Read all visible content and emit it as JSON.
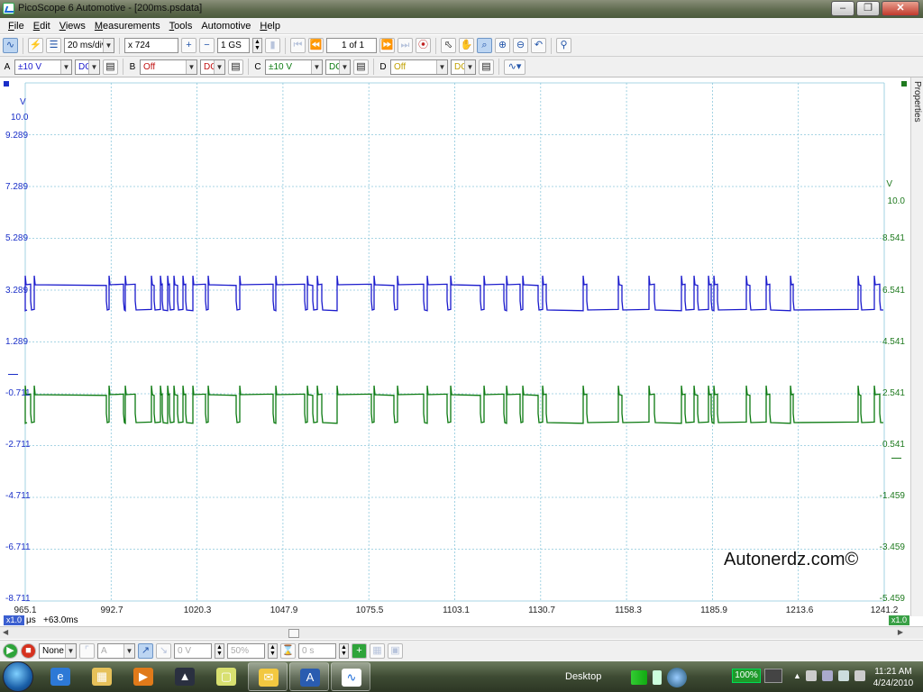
{
  "window": {
    "title": "PicoScope 6 Automotive - [200ms.psdata]",
    "minimize_icon": "minimize-icon",
    "maximize_icon": "restore-icon",
    "close_icon": "close-icon"
  },
  "menu": [
    {
      "label": "File",
      "key": "F",
      "rest": "ile"
    },
    {
      "label": "Edit",
      "key": "E",
      "rest": "dit"
    },
    {
      "label": "Views",
      "key": "V",
      "rest": "iews"
    },
    {
      "label": "Measurements",
      "key": "M",
      "rest": "easurements"
    },
    {
      "label": "Tools",
      "key": "T",
      "rest": "ools"
    },
    {
      "label": "Automotive",
      "key": "",
      "rest": "Automotive"
    },
    {
      "label": "Help",
      "key": "H",
      "rest": "elp"
    }
  ],
  "toolbar": {
    "timebase": "20 ms/div",
    "zoom": "x 724",
    "samples": "1 GS",
    "page": "1 of 1"
  },
  "channels": [
    {
      "letter": "A",
      "range": "±10 V",
      "coupling": "DC",
      "color": "#1a1acc"
    },
    {
      "letter": "B",
      "range": "Off",
      "coupling": "DC",
      "color": "#c01010"
    },
    {
      "letter": "C",
      "range": "±10 V",
      "coupling": "DC",
      "color": "#0b7a10"
    },
    {
      "letter": "D",
      "range": "Off",
      "coupling": "DC",
      "color": "#c0a000"
    }
  ],
  "axes": {
    "left_unit": "V",
    "left_ticks": [
      "10.0",
      "9.289",
      "7.289",
      "5.289",
      "3.289",
      "1.289",
      "-0.711",
      "-2.711",
      "-4.711",
      "-6.711",
      "-8.711"
    ],
    "right_unit": "V",
    "right_ticks": [
      "10.0",
      "8.541",
      "6.541",
      "4.541",
      "2.541",
      "0.541",
      "-1.459",
      "-3.459",
      "-5.459"
    ],
    "x_ticks": [
      "965.1",
      "992.7",
      "1020.3",
      "1047.9",
      "1075.5",
      "1103.1",
      "1130.7",
      "1158.3",
      "1185.9",
      "1213.6",
      "1241.2"
    ],
    "x_unit": "μs",
    "x_offset": "+63.0ms",
    "left_zoom_badge": "x1.0",
    "right_zoom_badge": "x1.0"
  },
  "properties_tab": "Properties",
  "watermark": "Autonerdz.com©",
  "bottom_toolbar": {
    "trigger_mode": "None",
    "trigger_channel": "A",
    "threshold": "0 V",
    "pretrigger": "50%",
    "delay": "0 s"
  },
  "taskbar": {
    "desktop_label": "Desktop",
    "battery": "100%",
    "time": "11:21 AM",
    "date": "4/24/2010"
  },
  "colors": {
    "channel_a": "#1a1acc",
    "channel_c": "#0b7a10",
    "grid": "#9fd0e0"
  }
}
